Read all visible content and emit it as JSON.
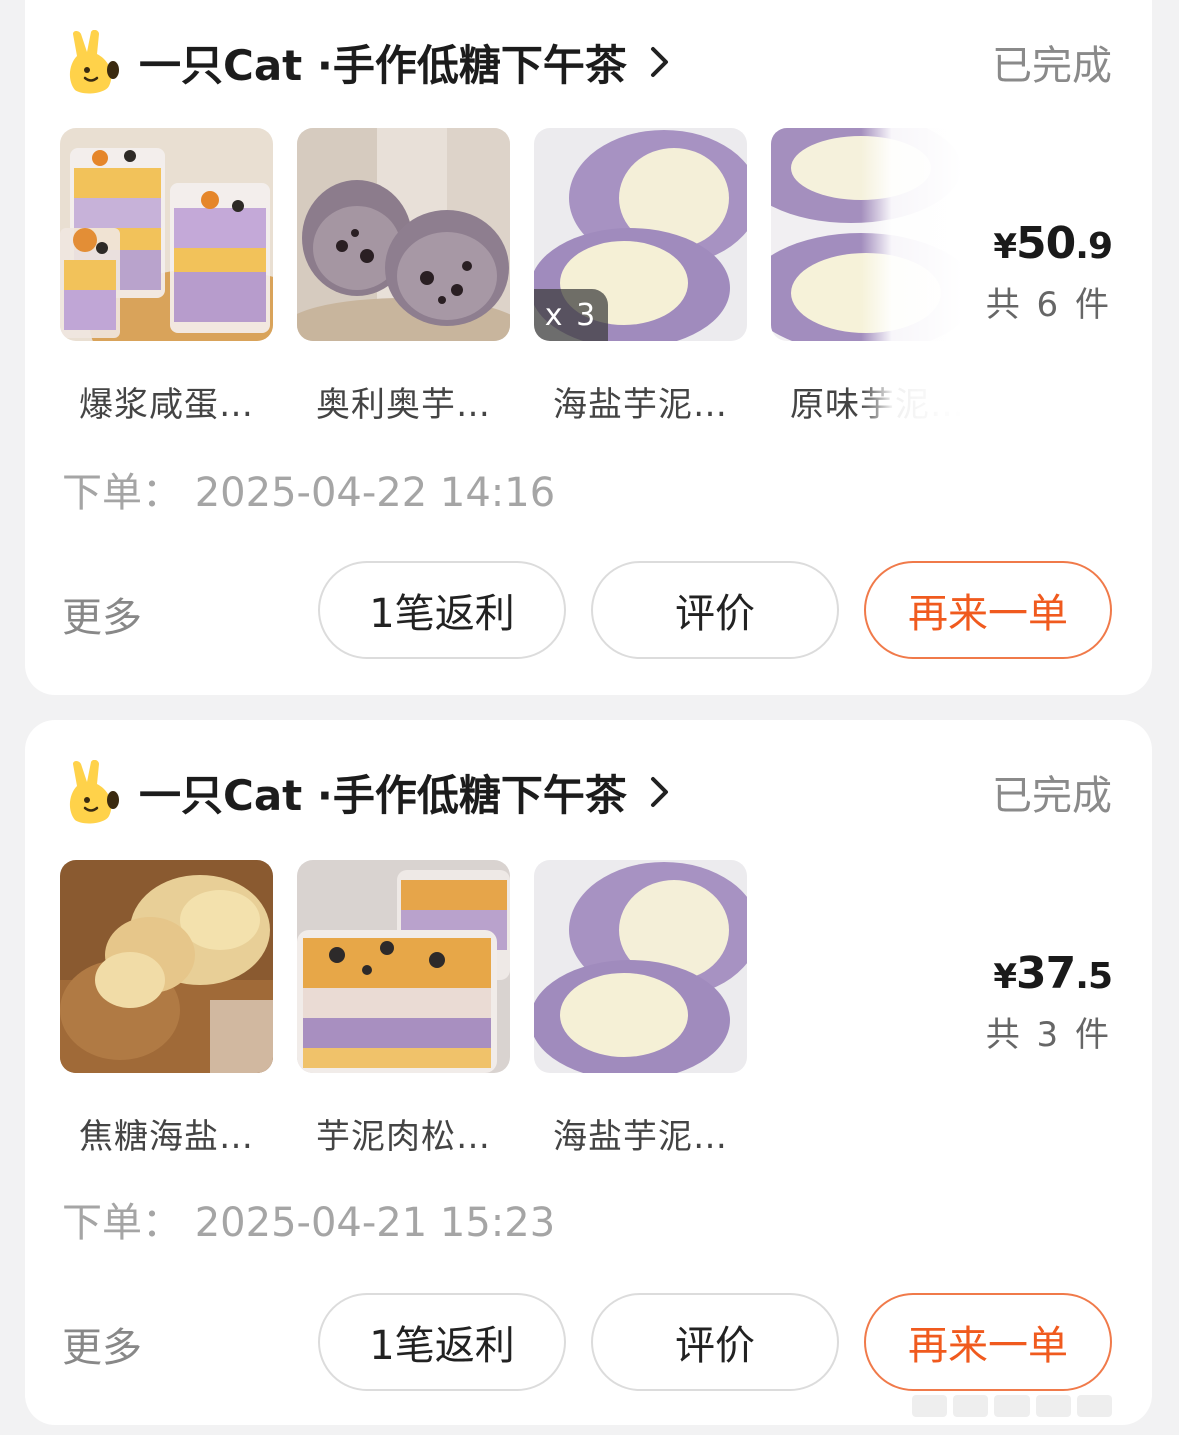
{
  "orders": [
    {
      "shop_name": "一只Cat ·手作低糖下午茶",
      "status": "已完成",
      "products": [
        {
          "name": "爆浆咸蛋…",
          "image": "salted-egg-yolk-cake-cup"
        },
        {
          "name": "奥利奥芋…",
          "image": "oreo-taro-mochi"
        },
        {
          "name": "海盐芋泥…",
          "image": "sea-salt-taro-mochi",
          "quantity": "x 3"
        },
        {
          "name": "原味芋泥…",
          "image": "original-taro-mochi"
        }
      ],
      "price_symbol": "¥",
      "price_int": "50",
      "price_dec": ".9",
      "item_count": "共 6 件",
      "order_time_label": "下单：",
      "order_time": "2025-04-22 14:16",
      "more_label": "更多",
      "buttons": {
        "rebate": "1笔返利",
        "review": "评价",
        "reorder": "再来一单"
      }
    },
    {
      "shop_name": "一只Cat ·手作低糖下午茶",
      "status": "已完成",
      "products": [
        {
          "name": "焦糖海盐…",
          "image": "caramel-sea-salt-puff-cup"
        },
        {
          "name": "芋泥肉松…",
          "image": "taro-pork-floss-box"
        },
        {
          "name": "海盐芋泥…",
          "image": "sea-salt-taro-mochi"
        }
      ],
      "price_symbol": "¥",
      "price_int": "37",
      "price_dec": ".5",
      "item_count": "共 3 件",
      "order_time_label": "下单：",
      "order_time": "2025-04-21 15:23",
      "more_label": "更多",
      "buttons": {
        "rebate": "1笔返利",
        "review": "评价",
        "reorder": "再来一单"
      }
    }
  ],
  "colors": {
    "accent": "#f05a1e",
    "accent_border": "#f07a4a",
    "logo_yellow": "#ffd24a",
    "taro_purple": "#a792c2"
  }
}
